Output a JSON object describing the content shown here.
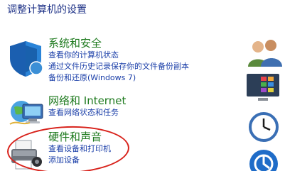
{
  "page_title": "调整计算机的设置",
  "categories": [
    {
      "title": "系统和安全",
      "icon": "shield-icon",
      "links": [
        "查看你的计算机状态",
        "通过文件历史记录保存你的文件备份副本",
        "备份和还原(Windows 7)"
      ]
    },
    {
      "title": "网络和 Internet",
      "icon": "network-globe-icon",
      "links": [
        "查看网络状态和任务"
      ]
    },
    {
      "title": "硬件和声音",
      "icon": "printer-icon",
      "links": [
        "查看设备和打印机",
        "添加设备"
      ]
    }
  ],
  "right_icons": [
    "user-accounts-icon",
    "appearance-icon",
    "clock-region-icon",
    "ease-of-access-icon"
  ],
  "colors": {
    "title": "#1e3287",
    "category_title": "#1e7a1e",
    "link": "#1a3ea8",
    "annotation": "#d8221b"
  }
}
